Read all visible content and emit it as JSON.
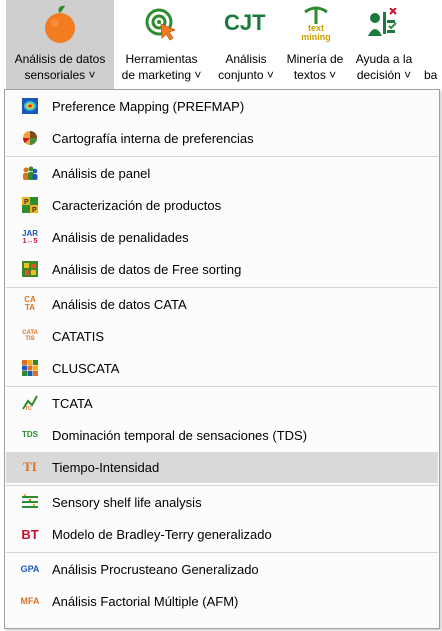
{
  "ribbon": {
    "buttons": [
      {
        "label1": "Análisis de datos",
        "label2": "sensoriales ˅",
        "icon": "orange-fruit-icon"
      },
      {
        "label1": "Herramientas",
        "label2": "de marketing ˅",
        "icon": "target-cursor-icon"
      },
      {
        "label1": "Análisis",
        "label2": "conjunto ˅",
        "icon_text": "CJT"
      },
      {
        "label1": "Minería de",
        "label2": "textos ˅",
        "icon_text": "text mining"
      },
      {
        "label1": "Ayuda a la",
        "label2": "decisión ˅",
        "icon": "decision-person-icon"
      },
      {
        "label2": "ba"
      }
    ]
  },
  "menu": {
    "items": [
      {
        "label": "Preference Mapping (PREFMAP)",
        "icon": "prefmap-icon"
      },
      {
        "label": "Cartografía interna de preferencias",
        "icon": "pie-chart-icon"
      },
      {
        "label": "Análisis de panel",
        "icon": "panel-people-icon"
      },
      {
        "label": "Caracterización de productos",
        "icon": "product-grid-icon",
        "icon_text": "P"
      },
      {
        "label": "Análisis de penalidades",
        "icon": "jar-icon",
        "icon_text": "JAR"
      },
      {
        "label": "Análisis de datos de Free sorting",
        "icon": "free-sorting-icon"
      },
      {
        "label": "Análisis de datos CATA",
        "icon": "cata-icon",
        "icon_text": "CA TA"
      },
      {
        "label": "CATATIS",
        "icon": "catatis-icon",
        "icon_text": "CATA TIS"
      },
      {
        "label": "CLUSCATA",
        "icon": "cluscata-icon"
      },
      {
        "label": "TCATA",
        "icon": "tcata-icon"
      },
      {
        "label": "Dominación temporal de sensaciones (TDS)",
        "icon": "tds-icon",
        "icon_text": "TDS"
      },
      {
        "label": "Tiempo-Intensidad",
        "icon": "ti-icon",
        "icon_text": "TI"
      },
      {
        "label": "Sensory shelf life analysis",
        "icon": "shelf-life-icon"
      },
      {
        "label": "Modelo de Bradley-Terry generalizado",
        "icon": "bt-icon",
        "icon_text": "BT"
      },
      {
        "label": "Análisis Procrusteano Generalizado",
        "icon": "gpa-icon",
        "icon_text": "GPA"
      },
      {
        "label": "Análisis Factorial Múltiple (AFM)",
        "icon": "mfa-icon",
        "icon_text": "MFA"
      }
    ],
    "highlighted_label": "Tiempo-Intensidad"
  },
  "colors": {
    "active_ribbon_bg": "#cfcfcf",
    "highlight_bg": "#d9d9d9",
    "orange": "#f47c20",
    "green": "#2e8b2e",
    "blue": "#1f57b5",
    "red": "#c8102e"
  }
}
